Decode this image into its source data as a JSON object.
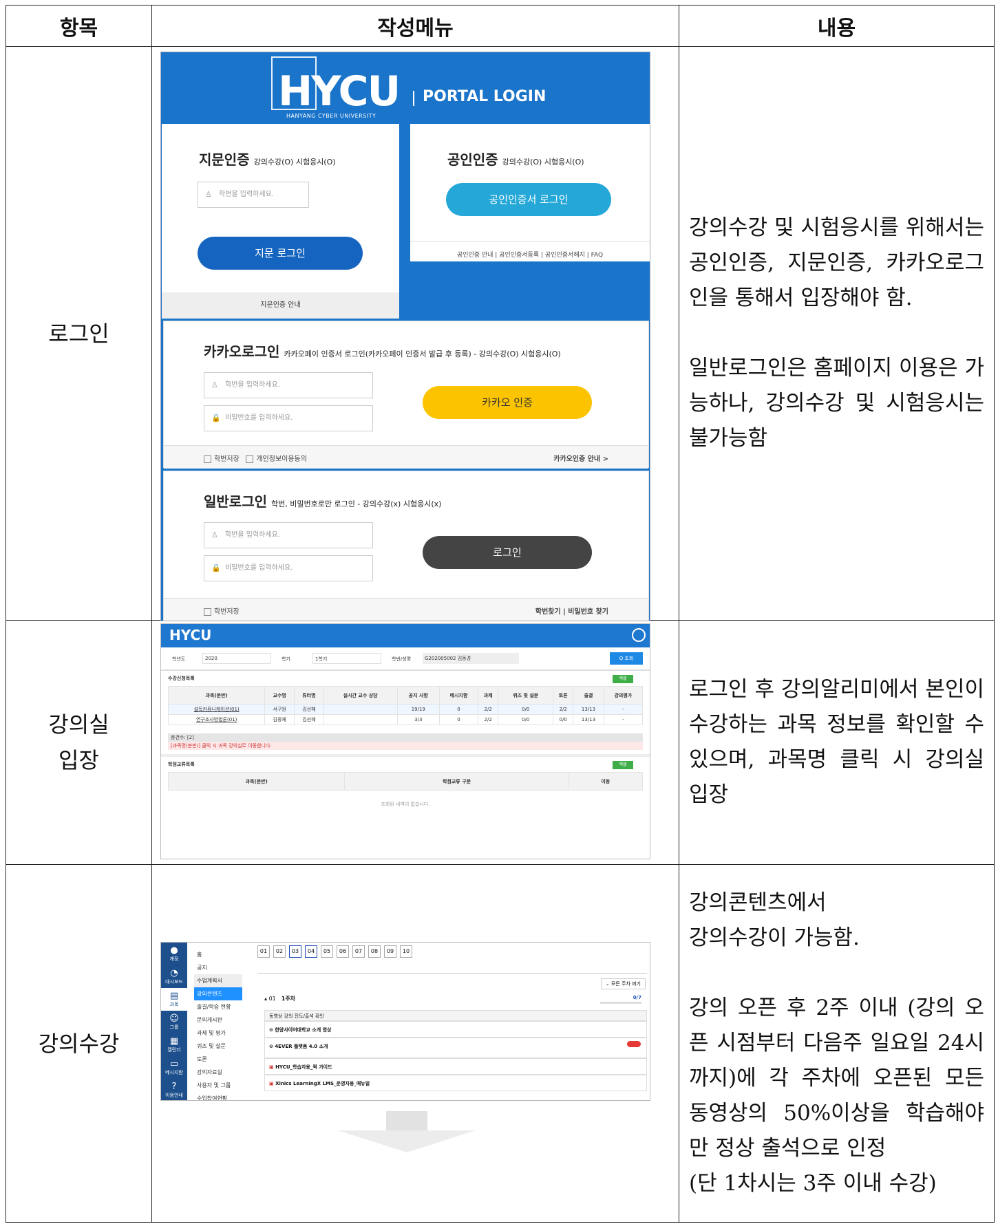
{
  "headers": {
    "col1": "항목",
    "col2": "작성메뉴",
    "col3": "내용"
  },
  "rows": {
    "login": {
      "item": "로그인",
      "desc1": "강의수강 및 시험응시를 위해서는 공인인증, 지문인증, 카카오로그인을 통해서 입장해야 함.",
      "desc2": "일반로그인은 홈페이지 이용은 가능하나, 강의수강 및 시험응시는 불가능함"
    },
    "classroom": {
      "item_line1": "강의실",
      "item_line2": "입장",
      "desc": "로그인 후 강의알리미에서 본인이 수강하는 과목 정보를 확인할 수 있으며, 과목명 클릭 시 강의실 입장"
    },
    "lecture": {
      "item": "강의수강",
      "desc1_line1": "강의콘텐츠에서",
      "desc1_line2": "강의수강이 가능함.",
      "desc2": "강의 오픈 후 2주 이내 (강의 오픈 시점부터 다음주 일요일 24시까지)에 각 주차에 오픈된 모든 동영상의 50%이상을 학습해야만 정상 출석으로 인정",
      "desc3": "(단 1차시는 3주 이내 수강)"
    }
  },
  "login_shot": {
    "logo": "HYCU",
    "logo_sub": "HANYANG CYBER UNIVERSITY",
    "portal": "PORTAL LOGIN",
    "finger": {
      "title": "지문인증",
      "sub": "강의수강(O) 시험응시(O)",
      "placeholder": "학번을 입력하세요.",
      "button": "지문 로그인",
      "footer": "지문인증 안내"
    },
    "cert": {
      "title": "공인인증",
      "sub": "강의수강(O) 시험응시(O)",
      "button": "공인인증서 로그인",
      "links": "공인인증 안내 | 공인인증서등록 | 공인인증서해지 | FAQ"
    },
    "kakao": {
      "title": "카카오로그인",
      "sub": "카카오페이 인증서 로그인(카카오페이 인증서 발급 후 등록) - 강의수강(O) 시험응시(O)",
      "id_ph": "학번을 입력하세요.",
      "pw_ph": "비밀번호를 입력하세요.",
      "button": "카카오 인증",
      "save": "학번저장",
      "agree": "개인정보이용동의",
      "guide": "카카오인증 안내 >"
    },
    "general": {
      "title": "일반로그인",
      "sub": "학번, 비밀번호로만 로그인 - 강의수강(x) 시험응시(x)",
      "id_ph": "학번을 입력하세요.",
      "pw_ph": "비밀번호를 입력하세요.",
      "button": "로그인",
      "save": "학번저장",
      "links": "학번찾기 | 비밀번호 찾기"
    }
  },
  "class_shot": {
    "logo": "HYCU",
    "filter": {
      "year_label": "학년도",
      "year": "2020",
      "term_label": "학기",
      "term": "1학기",
      "student_label": "학번/성명",
      "student": "G202005002 김동경",
      "search": "Q 조회"
    },
    "list_title": "수강신청목록",
    "columns": [
      "과목(분반)",
      "교수명",
      "튜터명",
      "실시간 교수 상담",
      "공지 사항",
      "메시지함",
      "과제",
      "퀴즈 및 설문",
      "토론",
      "출결",
      "강의평가"
    ],
    "rows": [
      [
        "설득커뮤니케이션(01)",
        "서구원",
        "김선혜",
        "",
        "19/19",
        "0",
        "2/2",
        "0/0",
        "2/2",
        "13/13",
        "-"
      ],
      [
        "연구조사방법론(01)",
        "김광재",
        "김선혜",
        "",
        "3/3",
        "0",
        "2/2",
        "0/0",
        "0/0",
        "13/13",
        "-"
      ]
    ],
    "total": "총건수: [2]",
    "notice": "[과목명(분반)] 클릭 시 과목 강의실로 이동합니다.",
    "excel": "엑셀",
    "credit_title": "학점교류목록",
    "credit_cols": [
      "과목(분반)",
      "학점교류 구분",
      "이동"
    ],
    "empty": "조회된 내역이 없습니다."
  },
  "lecture_shot": {
    "side": [
      "계정",
      "대시보드",
      "과목",
      "그룹",
      "캘린더",
      "메시지함",
      "이용안내"
    ],
    "menu": [
      "홈",
      "공지",
      "수업계획서",
      "강의콘텐츠",
      "출결/학습 현황",
      "문의게시판",
      "과제 및 평가",
      "퀴즈 및 설문",
      "토론",
      "강의자료실",
      "사용자 및 그룹",
      "수업참여현황"
    ],
    "weeks": [
      "01",
      "02",
      "03",
      "04",
      "05",
      "06",
      "07",
      "08",
      "09",
      "10"
    ],
    "fold": "모든 주차 펴기",
    "week_title": "1주차",
    "week_no": "01",
    "progress": "0/7",
    "section": "동영상 강의 진도/출석 확인",
    "items": [
      "한양사이버대학교 소개 영상",
      "4EVER 플랫폼 4.0 소개",
      "HYCU_학습자용_퀵 가이드",
      "Xinics LearningX LMS_운영자용_매뉴얼"
    ]
  }
}
